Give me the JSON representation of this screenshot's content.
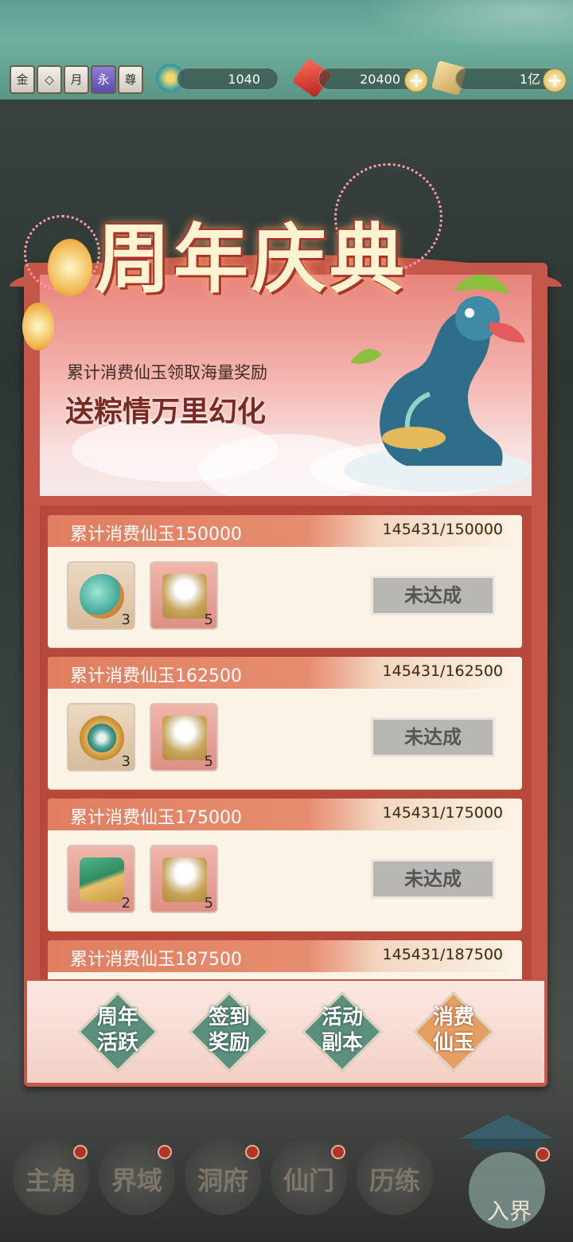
{
  "header": {
    "badges": [
      "金",
      "◇",
      "月",
      "永",
      "尊"
    ],
    "resources": [
      {
        "icon": "jade-swirl-icon",
        "value": "1040"
      },
      {
        "icon": "red-gem-icon",
        "value": "20400"
      },
      {
        "icon": "gold-scroll-icon",
        "value": "1亿"
      }
    ]
  },
  "banner": {
    "title": "周年庆典",
    "subtitle": "累计消费仙玉领取海量奖励",
    "slogan": "送粽情万里幻化"
  },
  "rewards": [
    {
      "title": "累计消费仙玉150000",
      "progress": "145431/150000",
      "items": [
        {
          "icon": "jade-orb-icon",
          "count": "3"
        },
        {
          "icon": "pearl-tray-icon",
          "count": "5"
        }
      ],
      "button": "未达成"
    },
    {
      "title": "累计消费仙玉162500",
      "progress": "145431/162500",
      "items": [
        {
          "icon": "jade-ring-icon",
          "count": "3"
        },
        {
          "icon": "pearl-tray-icon",
          "count": "5"
        }
      ],
      "button": "未达成"
    },
    {
      "title": "累计消费仙玉175000",
      "progress": "145431/175000",
      "items": [
        {
          "icon": "scroll-bundle-icon",
          "count": "2"
        },
        {
          "icon": "pearl-tray-icon",
          "count": "5"
        }
      ],
      "button": "未达成"
    },
    {
      "title": "累计消费仙玉187500",
      "progress": "145431/187500",
      "items": [],
      "button": ""
    }
  ],
  "tabs": [
    {
      "label": "周年\n活跃",
      "l1": "周年",
      "l2": "活跃",
      "active": false
    },
    {
      "label": "签到\n奖励",
      "l1": "签到",
      "l2": "奖励",
      "active": false
    },
    {
      "label": "活动\n副本",
      "l1": "活动",
      "l2": "副本",
      "active": false
    },
    {
      "label": "消费\n仙玉",
      "l1": "消费",
      "l2": "仙玉",
      "active": true
    }
  ],
  "nav": [
    {
      "label": "主角"
    },
    {
      "label": "界域"
    },
    {
      "label": "洞府"
    },
    {
      "label": "仙门"
    },
    {
      "label": "历练"
    },
    {
      "label": "入界"
    }
  ],
  "colors": {
    "panel": "#c4574a",
    "card": "#fbf4e6",
    "tab_active": "#e59f63",
    "tab_inactive": "#5b8f7e"
  }
}
